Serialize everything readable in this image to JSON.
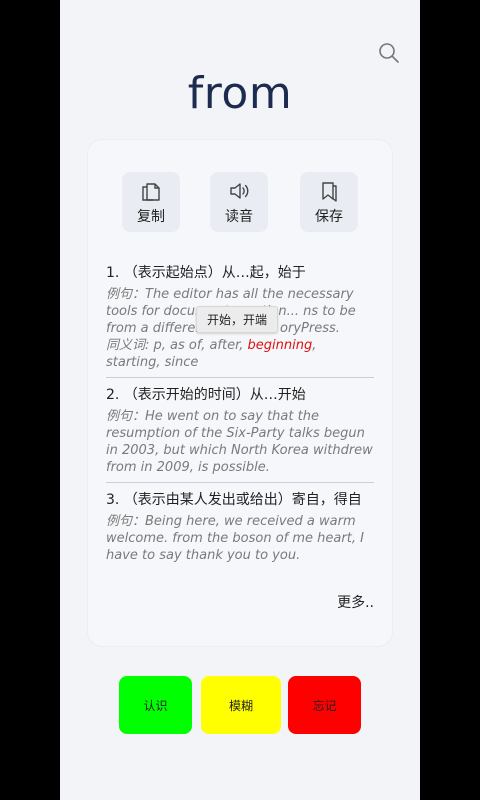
{
  "word": "from",
  "actions": {
    "copy_label": "复制",
    "read_label": "读音",
    "save_label": "保存"
  },
  "definitions": [
    {
      "title": "1. （表示起始点）从…起，始于",
      "example": "例句：The editor has all the necessary tools for document creation... ns to be from a different service ... oryPress.",
      "synonyms_prefix": "同义词: p, as of, after, ",
      "synonyms_highlight": "beginning",
      "synonyms_suffix": ", starting, since"
    },
    {
      "title": "2. （表示开始的时间）从…开始",
      "example": "例句：He went on to say that the resumption of the Six-Party talks begun in 2003, but which North Korea withdrew from in 2009, is possible."
    },
    {
      "title": "3. （表示由某人发出或给出）寄自，得自",
      "example": "例句：Being here, we received a warm welcome. from the boson of me heart, I have to say thank you to you."
    }
  ],
  "tooltip": "开始，开端",
  "more_label": "更多..",
  "buttons": {
    "know_label": "认识",
    "vague_label": "模糊",
    "forget_label": "忘记"
  },
  "colors": {
    "know": "#00ff00",
    "vague": "#ffff00",
    "forget": "#ff0000",
    "highlight": "#e01010"
  }
}
